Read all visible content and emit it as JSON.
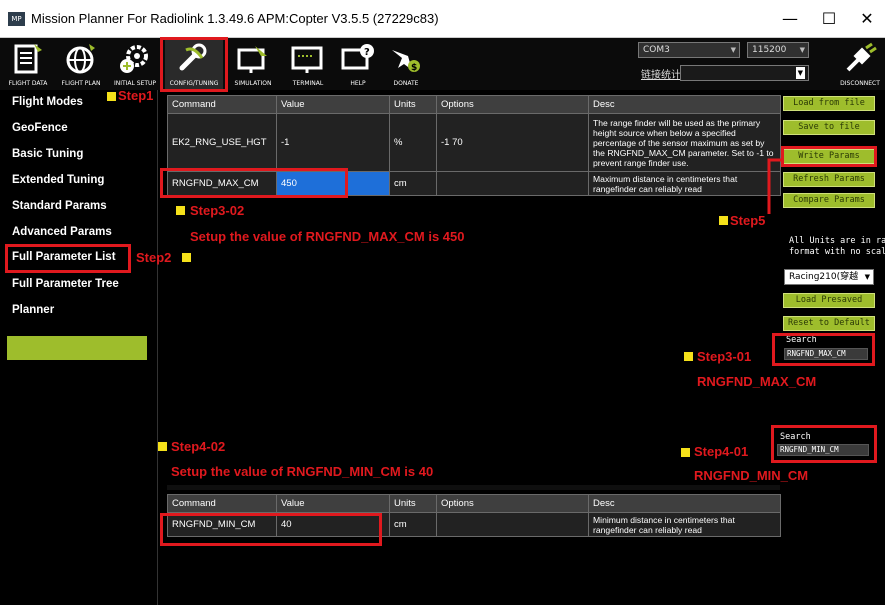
{
  "window": {
    "app_icon": "MP",
    "title": "Mission Planner For Radiolink 1.3.49.6 APM:Copter V3.5.5 (27229c83)",
    "minimize": "—",
    "maximize": "☐",
    "close": "✕"
  },
  "toolbar": {
    "items": [
      {
        "label": "FLIGHT DATA",
        "icon": "flight-data-icon"
      },
      {
        "label": "FLIGHT PLAN",
        "icon": "globe-icon"
      },
      {
        "label": "INITIAL SETUP",
        "icon": "gear-plus-icon"
      },
      {
        "label": "CONFIG/TUNING",
        "icon": "wrench-icon"
      },
      {
        "label": "SIMULATION",
        "icon": "monitor-plane-icon"
      },
      {
        "label": "TERMINAL",
        "icon": "terminal-icon"
      },
      {
        "label": "HELP",
        "icon": "help-monitor-icon"
      },
      {
        "label": "DONATE",
        "icon": "plane-dollar-icon"
      }
    ],
    "com_port": "COM3",
    "baud": "115200",
    "stats_label": "链接统计",
    "disconnect_label": "DISCONNECT"
  },
  "sidebar": {
    "items": [
      {
        "label": "Flight Modes"
      },
      {
        "label": "GeoFence"
      },
      {
        "label": "Basic Tuning"
      },
      {
        "label": "Extended Tuning"
      },
      {
        "label": "Standard Params"
      },
      {
        "label": "Advanced Params"
      },
      {
        "label": "Full Parameter List"
      },
      {
        "label": "Full Parameter Tree"
      },
      {
        "label": "Planner"
      }
    ]
  },
  "table_headers": [
    "Command",
    "Value",
    "Units",
    "Options",
    "Desc"
  ],
  "top_table": {
    "rows": [
      {
        "command": "EK2_RNG_USE_HGT",
        "value": "-1",
        "units": "%",
        "options": "-1 70",
        "desc": "The range finder will be used as the primary height source when below a specified percentage of the sensor maximum as set by the RNGFND_MAX_CM parameter. Set to -1 to prevent range finder use."
      },
      {
        "command": "RNGFND_MAX_CM",
        "value": "450",
        "units": "cm",
        "options": "",
        "desc": "Maximum distance in centimeters that rangefinder can reliably read"
      }
    ]
  },
  "bottom_table": {
    "rows": [
      {
        "command": "RNGFND_MIN_CM",
        "value": "40",
        "units": "cm",
        "options": "",
        "desc": "Minimum distance in centimeters that rangefinder can reliably read"
      }
    ]
  },
  "right_panel": {
    "load_from_file": "Load from file",
    "save_to_file": "Save to file",
    "write_params": "Write Params",
    "refresh_params": "Refresh Params",
    "compare_params": "Compare Params",
    "units_note_1": "All Units are in ra",
    "units_note_2": "format with no scal",
    "preset": "Racing210(穿越",
    "load_presaved": "Load Presaved",
    "reset_default": "Reset to Default",
    "search_label": "Search",
    "search1_value": "RNGFND_MAX_CM",
    "search2_value": "RNGFND_MIN_CM"
  },
  "annotations": {
    "step1": "Step1",
    "step2": "Step2",
    "step3_02": "Step3-02",
    "step3_02_text": "Setup the value of RNGFND_MAX_CM is 450",
    "step5": "Step5",
    "step3_01": "Step3-01",
    "step3_01_text": "RNGFND_MAX_CM",
    "step4_02": "Step4-02",
    "step4_02_text": "Setup the value of RNGFND_MIN_CM is 40",
    "step4_01": "Step4-01",
    "step4_01_text": "RNGFND_MIN_CM"
  },
  "colors": {
    "accent_green": "#9ebd2c",
    "annotation_red": "#e0191e",
    "marker_yellow": "#f5e11a",
    "selection_blue": "#1e6fd9"
  }
}
